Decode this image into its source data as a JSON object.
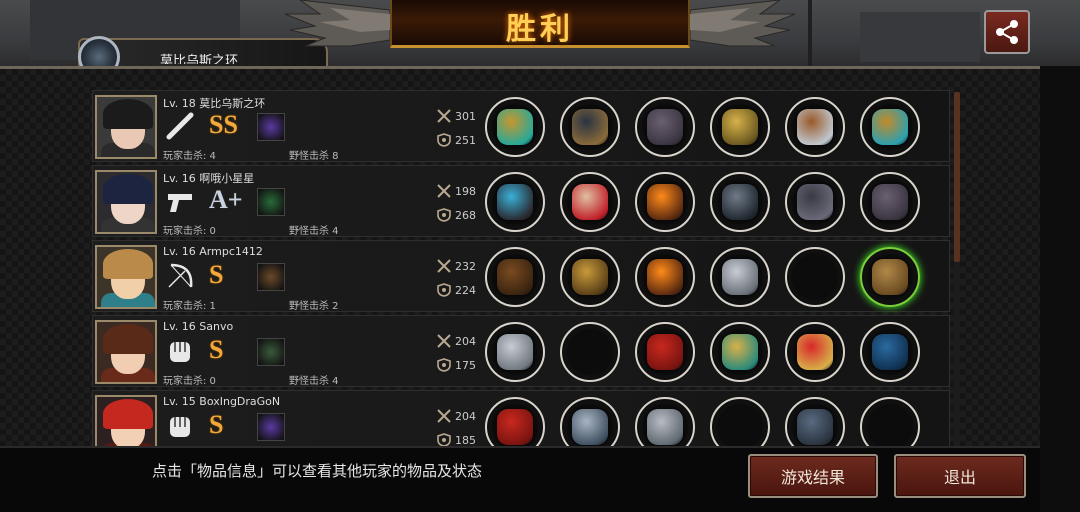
{
  "title": "胜利",
  "header_player": {
    "name": "莫比乌斯之环"
  },
  "icons": {
    "share": "share-icon",
    "attack": "crossed-swords-icon",
    "defense": "shield-icon"
  },
  "colors": {
    "title": "#ffcf57",
    "button_bg": "#6d2a1e",
    "grade_s": "#f2a93a",
    "slot_border": "#d8d4cc",
    "legendary_glow": "#49ff2a"
  },
  "players": [
    {
      "level": "Lv. 18",
      "name": "莫比乌斯之环",
      "weapon": "bat-icon",
      "grade": "SS",
      "skill": "purple-skill-icon",
      "player_kills": "玩家击杀: 4",
      "monster_kills": "野怪击杀 8",
      "attack": "301",
      "defense": "251",
      "items": [
        "spear-item",
        "dark-helmet-item",
        "plate-armor-item",
        "shield-item",
        "gauntlet-item",
        "earrings-item"
      ],
      "glow_item": -1
    },
    {
      "level": "Lv. 16",
      "name": "啊哦小星星",
      "weapon": "pistol-icon",
      "grade": "A+",
      "skill": "green-skill-icon",
      "player_kills": "玩家击杀: 0",
      "monster_kills": "野怪击杀 4",
      "attack": "198",
      "defense": "268",
      "items": [
        "energy-rifle-item",
        "wing-crown-item",
        "flame-helmet-item",
        "watch-item",
        "dark-glove-item",
        "plate-armor-item"
      ],
      "glow_item": -1
    },
    {
      "level": "Lv. 16",
      "name": "Armpc1412",
      "weapon": "bow-icon",
      "grade": "S",
      "skill": "cross-skill-icon",
      "player_kills": "玩家击杀: 1",
      "monster_kills": "野怪击杀 2",
      "attack": "232",
      "defense": "224",
      "items": [
        "crossbow-item",
        "gold-helmet-item",
        "flame-helmet-item",
        "spiked-bracer-item",
        "empty",
        "treasure-box-item"
      ],
      "glow_item": 5
    },
    {
      "level": "Lv. 16",
      "name": "Sanvo",
      "weapon": "fist-icon",
      "grade": "S",
      "skill": "green-claw-skill-icon",
      "player_kills": "玩家击杀: 0",
      "monster_kills": "野怪击杀 4",
      "attack": "204",
      "defense": "175",
      "items": [
        "silver-gauntlet-item",
        "empty",
        "red-shirt-item",
        "gold-bracelet-item",
        "red-heels-item",
        "blue-orb-item"
      ],
      "glow_item": -1
    },
    {
      "level": "Lv. 15",
      "name": "BoxIngDraGoN",
      "weapon": "fist-icon",
      "grade": "S",
      "skill": "purple-skill-icon",
      "player_kills": "",
      "monster_kills": "",
      "attack": "204",
      "defense": "185",
      "items": [
        "red-fist-item",
        "steel-helmet-item",
        "silver-armor-item",
        "empty",
        "blue-boots-item",
        "empty"
      ],
      "glow_item": -1
    }
  ],
  "footer": {
    "hint": "点击「物品信息」可以查看其他玩家的物品及状态",
    "results_button": "游戏结果",
    "exit_button": "退出"
  }
}
